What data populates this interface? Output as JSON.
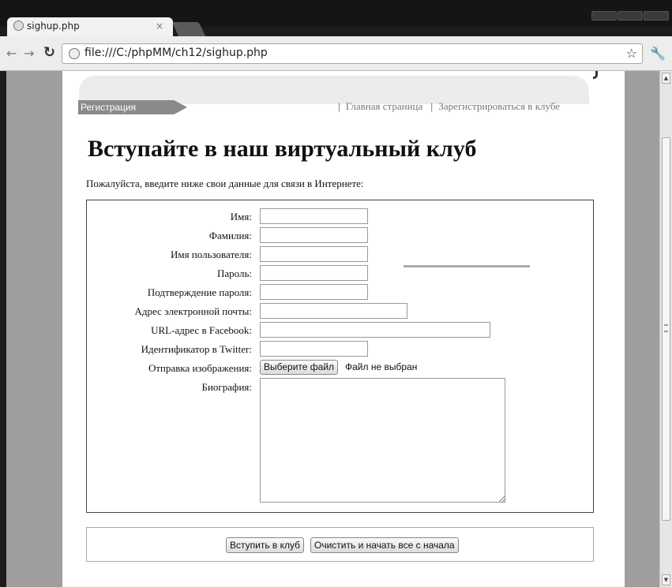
{
  "browser": {
    "tab_title": "sighup.php",
    "tab_close": "×",
    "url": "file:///C:/phpMM/ch12/sighup.php"
  },
  "header": {
    "section_tab": "Регистрация",
    "nav_separator": "|",
    "nav_home": "Главная страница",
    "nav_join": "Зарегистрироваться в клубе"
  },
  "page": {
    "title": "Вступайте в наш виртуальный клуб",
    "intro": "Пожалуйста, введите ниже свои данные для связи в Интернете:"
  },
  "form": {
    "first_name_label": "Имя:",
    "last_name_label": "Фамилия:",
    "username_label": "Имя пользователя:",
    "password_label": "Пароль:",
    "password_confirm_label": "Подтверждение пароля:",
    "email_label": "Адрес электронной почты:",
    "facebook_label": "URL-адрес в Facebook:",
    "twitter_label": "Идентификатор в Twitter:",
    "image_label": "Отправка изображения:",
    "file_button": "Выберите файл",
    "file_status": "Файл не выбран",
    "bio_label": "Биография:"
  },
  "buttons": {
    "join": "Вступить в клуб",
    "reset": "Очистить и начать все с начала"
  }
}
